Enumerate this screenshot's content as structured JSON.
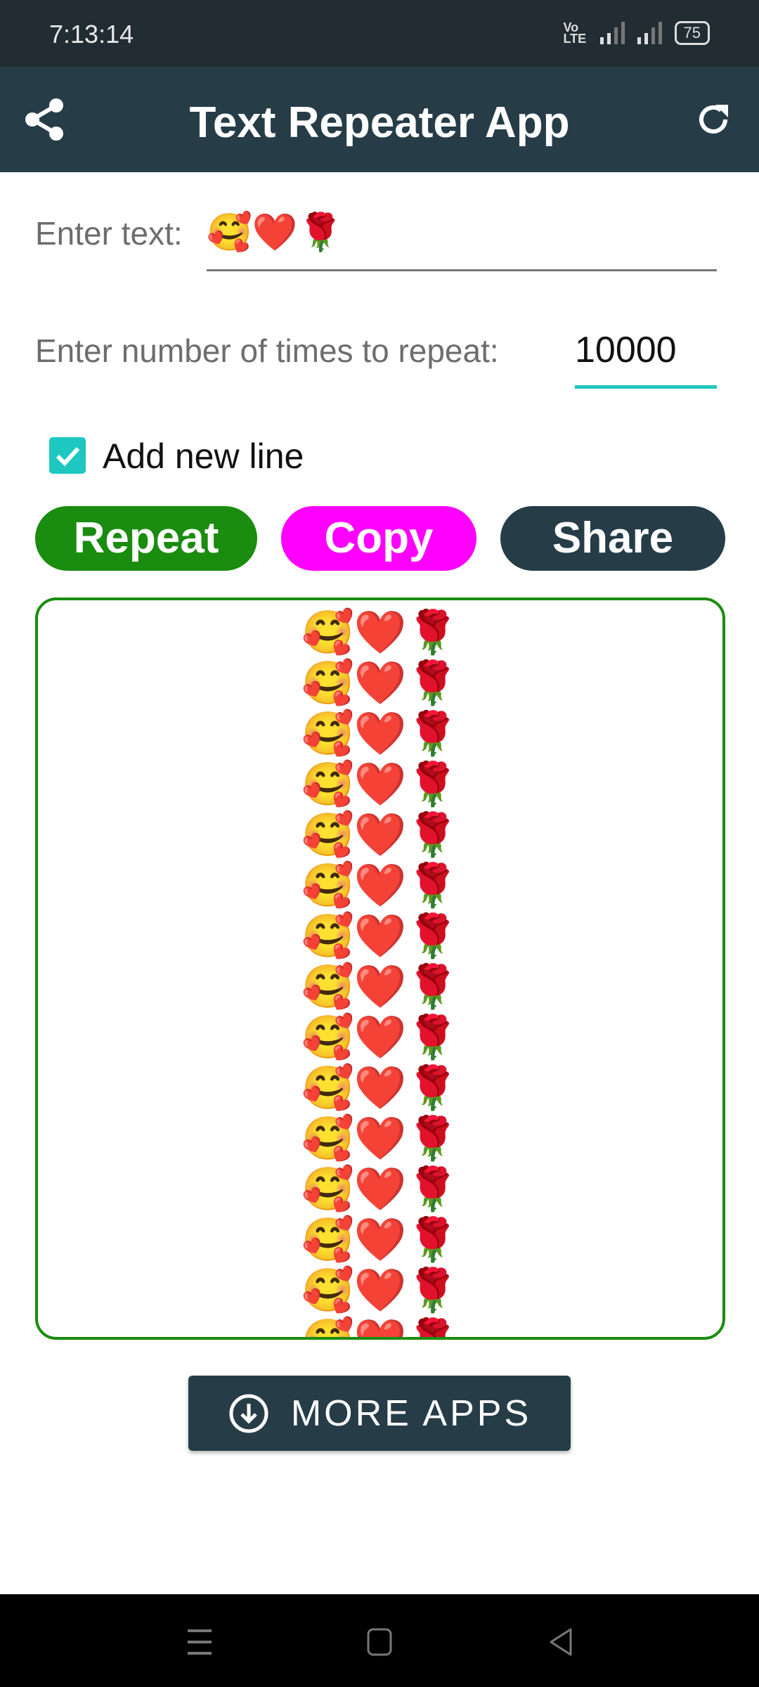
{
  "status_bar": {
    "time": "7:13:14",
    "network": "Vo LTE",
    "battery": "75"
  },
  "app_bar": {
    "title": "Text Repeater App",
    "left_icon": "share-icon",
    "right_icon": "refresh-icon"
  },
  "form": {
    "text_label": "Enter text:",
    "text_value": "🥰❤️🌹",
    "count_label": "Enter number of times to repeat:",
    "count_value": "10000",
    "newline_label": "Add new line",
    "newline_checked": true
  },
  "buttons": {
    "repeat": {
      "label": "Repeat",
      "color": "#1a8c0f"
    },
    "copy": {
      "label": "Copy",
      "color": "#ff00ff"
    },
    "share": {
      "label": "Share",
      "color": "#263d48"
    }
  },
  "output": {
    "text": "🥰❤️🌹\n🥰❤️🌹\n🥰❤️🌹\n🥰❤️🌹\n🥰❤️🌹\n🥰❤️🌹\n🥰❤️🌹\n🥰❤️🌹\n🥰❤️🌹\n🥰❤️🌹\n🥰❤️🌹\n🥰❤️🌹\n🥰❤️🌹\n🥰❤️🌹\n🥰❤️🌹"
  },
  "more_apps": {
    "label": "MORE APPS",
    "icon": "download-circle-icon"
  },
  "colors": {
    "primary": "#263d48",
    "accent": "#1ec8c0"
  }
}
